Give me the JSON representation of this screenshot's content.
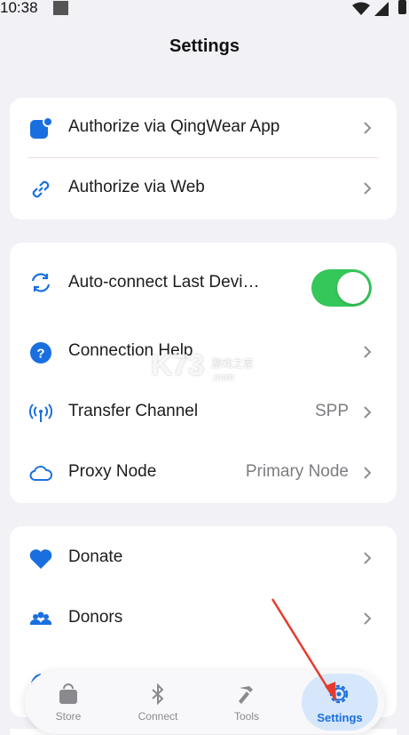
{
  "status_bar": {
    "time": "10:38"
  },
  "page": {
    "title": "Settings"
  },
  "group1": [
    {
      "label": "Authorize via QingWear App",
      "icon": "qingwear-app-icon"
    },
    {
      "label": "Authorize via Web",
      "icon": "link-icon"
    }
  ],
  "group2": {
    "auto_connect": {
      "label": "Auto-connect Last Devi…",
      "enabled": true
    },
    "connection_help": {
      "label": "Connection Help"
    },
    "transfer_channel": {
      "label": "Transfer Channel",
      "value": "SPP"
    },
    "proxy_node": {
      "label": "Proxy Node",
      "value": "Primary Node"
    }
  },
  "group3": [
    {
      "label": "Donate",
      "icon": "heart-icon"
    },
    {
      "label": "Donors",
      "icon": "people-icon"
    }
  ],
  "watermark": {
    "main": "K73",
    "sub": "游戏之家",
    "sub2": ".com"
  },
  "tabbar": {
    "store": "Store",
    "connect": "Connect",
    "tools": "Tools",
    "settings": "Settings",
    "active": "settings"
  },
  "colors": {
    "accent": "#1a6fe0",
    "toggle_on": "#35c759",
    "annotation_arrow": "#e53b2c"
  }
}
